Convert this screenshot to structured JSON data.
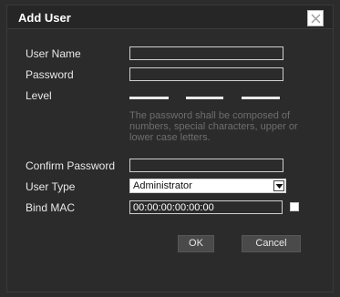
{
  "dialog": {
    "title": "Add User",
    "close_icon": "close-icon"
  },
  "form": {
    "user_name_label": "User Name",
    "user_name_value": "",
    "password_label": "Password",
    "password_value": "",
    "level_label": "Level",
    "password_hint": "The password shall be composed of numbers, special characters, upper or lower case letters.",
    "confirm_password_label": "Confirm Password",
    "confirm_password_value": "",
    "user_type_label": "User Type",
    "user_type_selected": "Administrator",
    "bind_mac_label": "Bind MAC",
    "bind_mac_value": "00:00:00:00:00:00",
    "bind_mac_checked": false
  },
  "buttons": {
    "ok": "OK",
    "cancel": "Cancel"
  },
  "colors": {
    "background": "#2b2b2b",
    "hint": "#6e6e6e",
    "button": "#4a4a4a"
  }
}
